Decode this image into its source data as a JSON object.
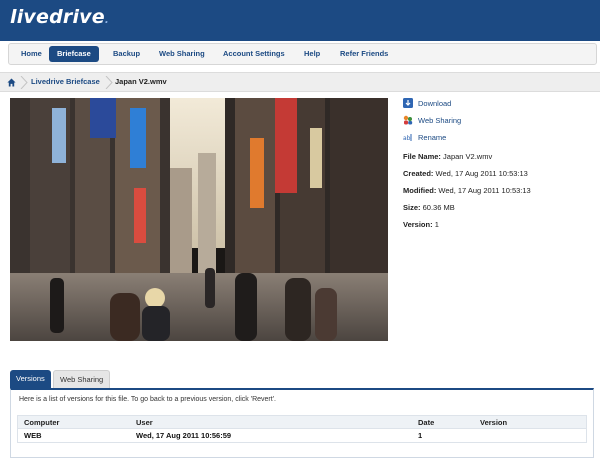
{
  "brand": {
    "logo_text": "livedrive",
    "logo_dot": "."
  },
  "nav": {
    "items": [
      {
        "label": "Home",
        "active": false
      },
      {
        "label": "Briefcase",
        "active": true
      },
      {
        "label": "Backup",
        "active": false
      },
      {
        "label": "Web Sharing",
        "active": false
      },
      {
        "label": "Account Settings",
        "active": false
      },
      {
        "label": "Help",
        "active": false
      },
      {
        "label": "Refer Friends",
        "active": false
      }
    ]
  },
  "breadcrumb": {
    "home_icon": "home-icon",
    "parent": "Livedrive Briefcase",
    "current": "Japan V2.wmv"
  },
  "actions": [
    {
      "label": "Download",
      "icon": "download-icon"
    },
    {
      "label": "Web Sharing",
      "icon": "web-sharing-icon"
    },
    {
      "label": "Rename",
      "icon": "rename-icon"
    }
  ],
  "file_info": {
    "name_label": "File Name:",
    "name_value": "Japan V2.wmv",
    "created_label": "Created:",
    "created_value": "Wed, 17 Aug 2011 10:53:13",
    "modified_label": "Modified:",
    "modified_value": "Wed, 17 Aug 2011 10:53:13",
    "size_label": "Size:",
    "size_value": "60.36 MB",
    "version_label": "Version:",
    "version_value": "1"
  },
  "tabs": [
    {
      "label": "Versions",
      "active": true
    },
    {
      "label": "Web Sharing",
      "active": false
    }
  ],
  "versions": {
    "note": "Here is a list of versions for this file. To go back to a previous version, click 'Revert'.",
    "columns": [
      "Computer",
      "User",
      "Date",
      "Version"
    ],
    "rows": [
      {
        "computer": "WEB",
        "user": "Wed, 17 Aug 2011 10:56:59",
        "date": "1",
        "version": ""
      }
    ]
  },
  "colors": {
    "brand_blue": "#1c4a83",
    "nav_bg": "#f4f4f4",
    "panel_border": "#cfd8e3"
  }
}
